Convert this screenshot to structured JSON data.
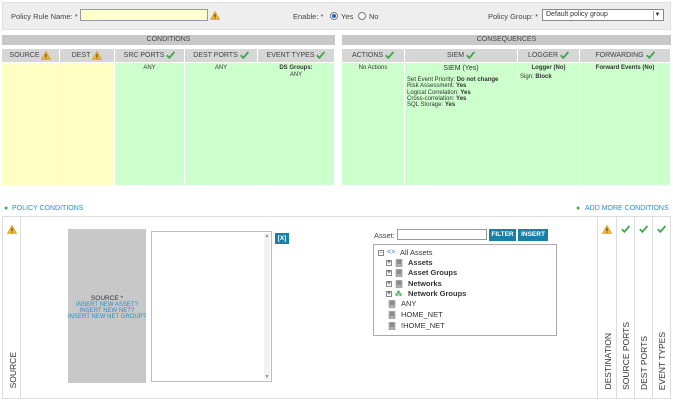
{
  "header": {
    "policy_rule_name_label": "Policy Rule Name: *",
    "enable_label": "Enable: *",
    "enable_yes": "Yes",
    "enable_no": "No",
    "policy_group_label": "Policy Group: *",
    "policy_group_value": "Default policy group"
  },
  "conditions": {
    "title": "CONDITIONS",
    "columns": [
      {
        "label": "SOURCE",
        "value": ""
      },
      {
        "label": "DEST",
        "value": ""
      },
      {
        "label": "SRC PORTS",
        "value": "ANY"
      },
      {
        "label": "DEST PORTS",
        "value": "ANY"
      },
      {
        "label": "EVENT TYPES",
        "value": "DS Groups:",
        "value2": "ANY"
      }
    ]
  },
  "consequences": {
    "title": "CONSEQUENCES",
    "actions": {
      "label": "ACTIONS",
      "value": "No Actions"
    },
    "siem": {
      "label": "SIEM",
      "value": "SIEM (Yes)",
      "details": [
        {
          "k": "Set Event Priority:",
          "v": "Do not change"
        },
        {
          "k": "Risk Assessment:",
          "v": "Yes"
        },
        {
          "k": "Logical Correlation:",
          "v": "Yes"
        },
        {
          "k": "Cross-correlation:",
          "v": "Yes"
        },
        {
          "k": "SQL Storage:",
          "v": "Yes"
        }
      ]
    },
    "logger": {
      "label": "LOGGER",
      "value": "Logger (No)",
      "sign_k": "Sign:",
      "sign_v": "Block"
    },
    "forwarding": {
      "label": "FORWARDING",
      "value": "Forward Events (No)"
    }
  },
  "links": {
    "policy_conditions": "POLICY CONDITIONS",
    "add_more_conditions": "ADD MORE CONDITIONS"
  },
  "source_panel": {
    "vertical_label": "SOURCE",
    "box_title": "SOURCE *",
    "insert_asset": "INSERT NEW ASSET?",
    "insert_net": "INSERT NEW NET?",
    "insert_net_group": "INSERT NEW NET GROUP?",
    "remove_button": "[X]"
  },
  "asset_picker": {
    "label": "Asset:",
    "filter_button": "FILTER",
    "insert_button": "INSERT",
    "tree": [
      {
        "label": "All Assets",
        "bold": false
      },
      {
        "label": "Assets",
        "bold": true
      },
      {
        "label": "Asset Groups",
        "bold": true
      },
      {
        "label": "Networks",
        "bold": true
      },
      {
        "label": "Network Groups",
        "bold": true
      },
      {
        "label": "ANY",
        "bold": false
      },
      {
        "label": "HOME_NET",
        "bold": false
      },
      {
        "label": "!HOME_NET",
        "bold": false
      }
    ]
  },
  "right_tabs": [
    "DESTINATION",
    "SOURCE PORTS",
    "DEST PORTS",
    "EVENT TYPES"
  ],
  "colors": {
    "yellow_cell": "#ffffc4",
    "green_cell": "#ccffcc",
    "accent_blue": "#1a7fa5",
    "link_blue": "#2a8fc4",
    "check_green": "#3aa84a",
    "warn_orange": "#f0a020"
  }
}
